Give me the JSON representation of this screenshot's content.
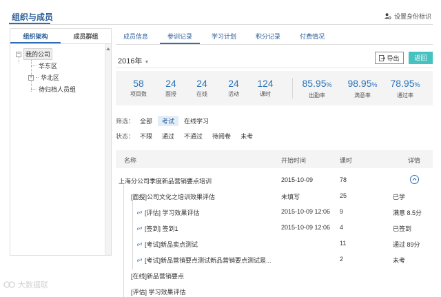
{
  "header": {
    "title": "组织与成员",
    "identity_link": "设置身份标识"
  },
  "sidebar": {
    "tabs": [
      "组织架构",
      "成员群组"
    ],
    "tree": {
      "root": "我的公司",
      "children": [
        "华东区",
        "华北区",
        "待归档人员组"
      ]
    }
  },
  "main": {
    "tabs": [
      "成员信息",
      "参训记录",
      "学习计划",
      "积分记录",
      "付费情况"
    ],
    "active_tab": 1,
    "year": "2016年",
    "export_label": "导出",
    "back_label": "返回",
    "stats": [
      {
        "value": "58",
        "label": "项目数"
      },
      {
        "value": "24",
        "label": "面授"
      },
      {
        "value": "24",
        "label": "在线"
      },
      {
        "value": "24",
        "label": "活动"
      },
      {
        "value": "124",
        "label": "课时"
      },
      {
        "value": "85.95",
        "unit": "%",
        "label": "出勤率"
      },
      {
        "value": "98.95",
        "unit": "%",
        "label": "满意率"
      },
      {
        "value": "78.95",
        "unit": "%",
        "label": "通过率"
      }
    ],
    "filter": {
      "label": "筛选：",
      "options": [
        "全部",
        "考试",
        "在线学习"
      ],
      "active": 1
    },
    "status": {
      "label": "状态：",
      "options": [
        "不限",
        "通过",
        "不通过",
        "待阅卷",
        "未考"
      ]
    },
    "table": {
      "headers": {
        "name": "名称",
        "start": "开始时间",
        "hours": "课时",
        "detail": "详情"
      },
      "rows": [
        {
          "name": "上海分公司季度新品营销要点培训",
          "start": "2015-10-09",
          "hours": "78",
          "detail": "",
          "level": 0
        },
        {
          "name": "[面授]公司文化之培训效果评估",
          "start": "未填写",
          "hours": "25",
          "detail": "已学",
          "level": 1
        },
        {
          "name": "[评估] 学习效果评估",
          "start": "2015-10-09 12:06",
          "hours": "9",
          "detail": "满意  8.5分",
          "level": 2
        },
        {
          "name": "[签到] 签到1",
          "start": "2015-10-09 12:06",
          "hours": "4",
          "detail": "已签到",
          "level": 2
        },
        {
          "name": "[考试]新品卖点测试",
          "start": "",
          "hours": "11",
          "detail": "通过  89分",
          "level": 2
        },
        {
          "name": "[考试]新品营销要点测试新品营销要点测试是...",
          "start": "",
          "hours": "2",
          "detail": "未考",
          "level": 2
        },
        {
          "name": "[在线]新品营销要点",
          "start": "",
          "hours": "",
          "detail": "",
          "level": 1
        },
        {
          "name": "[评估] 学习效果评估",
          "start": "",
          "hours": "",
          "detail": "",
          "level": 1
        }
      ]
    }
  },
  "watermark": "大数据联",
  "colors": {
    "accent": "#2f6cb5",
    "teal": "#46c2c0",
    "text_blue": "#2a73b8"
  }
}
